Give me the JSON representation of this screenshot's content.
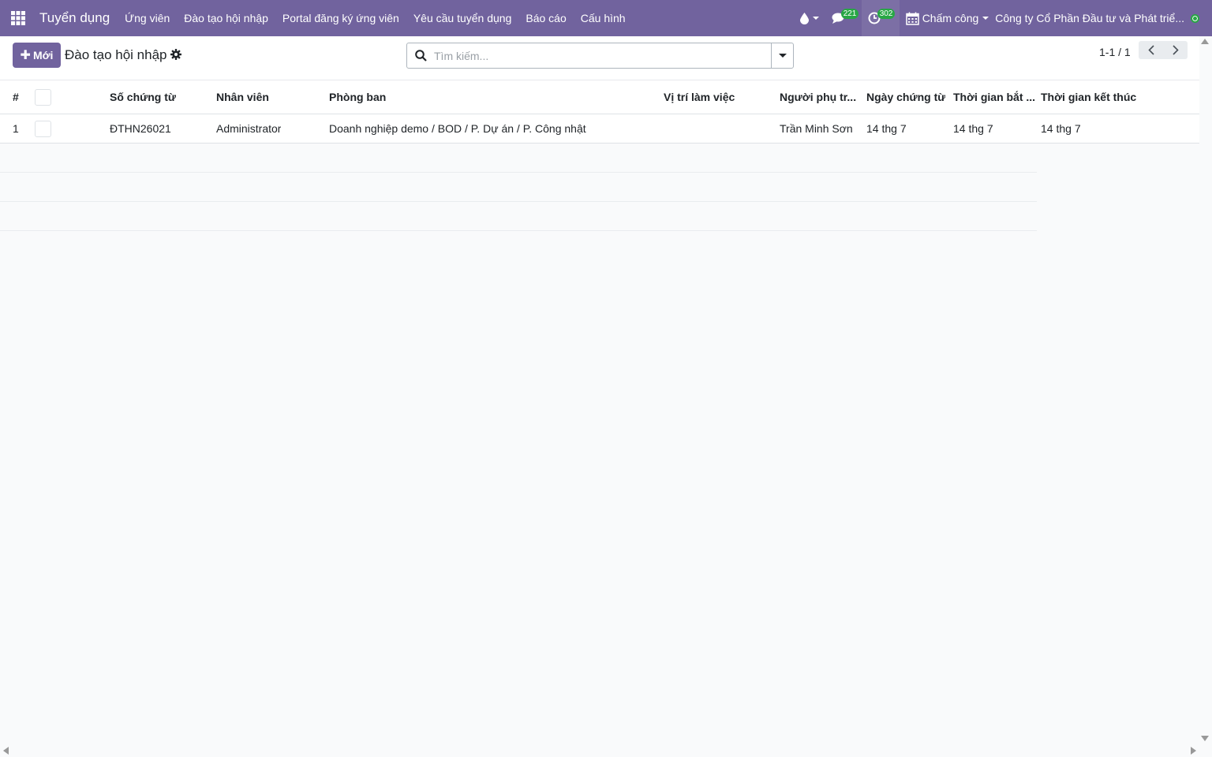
{
  "navbar": {
    "app_title": "Tuyển dụng",
    "menu": [
      "Ứng viên",
      "Đào tạo hội nhập",
      "Portal đăng ký ứng viên",
      "Yêu cầu tuyển dụng",
      "Báo cáo",
      "Cấu hình"
    ],
    "messages_count": "221",
    "activities_count": "302",
    "attendance_label": "Chấm công",
    "company": "Công ty Cổ Phần Đầu tư và Phát triể...",
    "brand_color": "#71639e",
    "badge_color": "#28a745"
  },
  "control_panel": {
    "new_label": "Mới",
    "breadcrumb": "Đào tạo hội nhập",
    "search_placeholder": "Tìm kiếm...",
    "pager": "1-1 / 1"
  },
  "table": {
    "columns": {
      "index": "#",
      "doc_number": "Số chứng từ",
      "employee": "Nhân viên",
      "department": "Phòng ban",
      "work_position": "Vị trí làm việc",
      "responsible": "Người phụ tr...",
      "doc_date": "Ngày chứng từ",
      "start_time": "Thời gian bắt ...",
      "end_time": "Thời gian kết thúc"
    },
    "rows": [
      {
        "index": "1",
        "doc_number": "ĐTHN26021",
        "employee": "Administrator",
        "department": "Doanh nghiệp demo / BOD / P. Dự án / P. Công nhật",
        "work_position": "",
        "responsible": "Trần Minh Sơn",
        "doc_date": "14 thg 7",
        "start_time": "14 thg 7",
        "end_time": "14 thg 7"
      }
    ]
  }
}
